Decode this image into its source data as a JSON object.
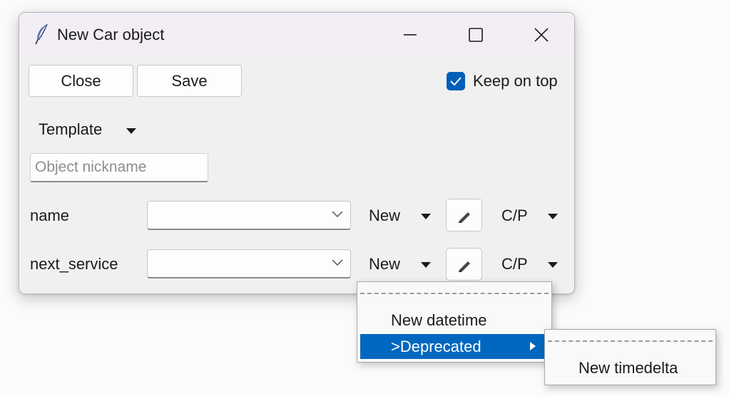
{
  "window": {
    "title": "New Car object",
    "icon": "feather-icon"
  },
  "toolbar": {
    "close_label": "Close",
    "save_label": "Save",
    "keep_on_top_label": "Keep on top",
    "keep_on_top_checked": true
  },
  "template_menu": {
    "label": "Template"
  },
  "nickname": {
    "placeholder": "Object nickname",
    "value": ""
  },
  "fields": [
    {
      "label": "name",
      "value": "",
      "new_label": "New",
      "cp_label": "C/P",
      "edit_icon": "pencil-icon"
    },
    {
      "label": "next_service",
      "value": "",
      "new_label": "New",
      "cp_label": "C/P",
      "edit_icon": "pencil-icon"
    }
  ],
  "new_menu": {
    "items": [
      "New datetime",
      ">Deprecated"
    ],
    "highlighted": ">Deprecated"
  },
  "deprecated_submenu": {
    "items": [
      "New timedelta"
    ]
  },
  "colors": {
    "accent": "#005fb8",
    "highlight": "#0067c0",
    "titlebar": "#f3eef6",
    "window_bg": "#f0f0f0"
  }
}
